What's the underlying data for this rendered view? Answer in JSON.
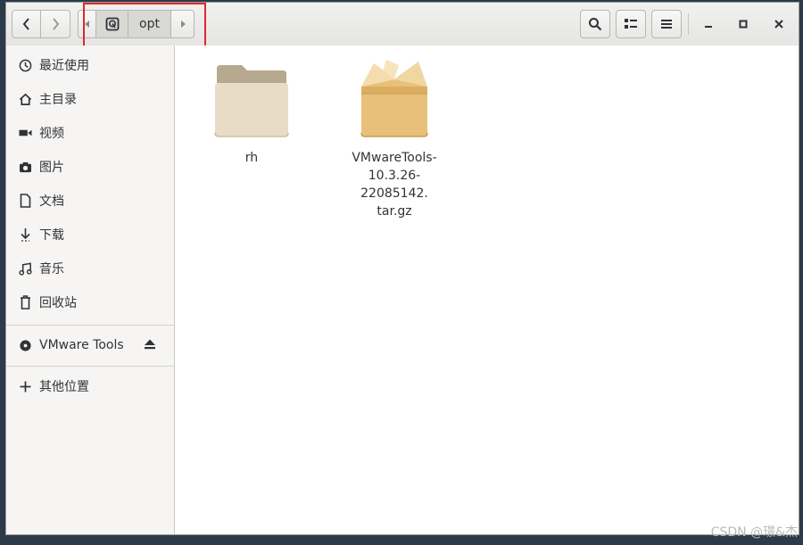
{
  "header": {
    "back_icon": "chevron-left-icon",
    "forward_icon": "chevron-right-icon",
    "path_current": "opt",
    "search_icon": "search-icon",
    "view_icon": "list-view-icon",
    "menu_icon": "hamburger-menu-icon",
    "minimize_icon": "minimize-icon",
    "maximize_icon": "maximize-icon",
    "close_icon": "close-icon",
    "highlight_color": "#e0262c"
  },
  "sidebar": {
    "items": [
      {
        "label": "最近使用",
        "icon": "recent-icon"
      },
      {
        "label": "主目录",
        "icon": "home-icon"
      },
      {
        "label": "视频",
        "icon": "video-icon"
      },
      {
        "label": "图片",
        "icon": "camera-icon"
      },
      {
        "label": "文档",
        "icon": "document-icon"
      },
      {
        "label": "下载",
        "icon": "download-icon"
      },
      {
        "label": "音乐",
        "icon": "music-icon"
      },
      {
        "label": "回收站",
        "icon": "trash-icon"
      }
    ],
    "devices": [
      {
        "label": "VMware Tools",
        "icon": "disc-icon",
        "action_icon": "eject-icon"
      }
    ],
    "other": {
      "label": "其他位置",
      "icon": "plus-icon"
    }
  },
  "files": [
    {
      "name": "rh",
      "type": "folder"
    },
    {
      "name_lines": [
        "VMwareTools-",
        "10.3.26-22085142.",
        "tar.gz"
      ],
      "type": "archive"
    }
  ],
  "watermark": "CSDN @璟&杰"
}
